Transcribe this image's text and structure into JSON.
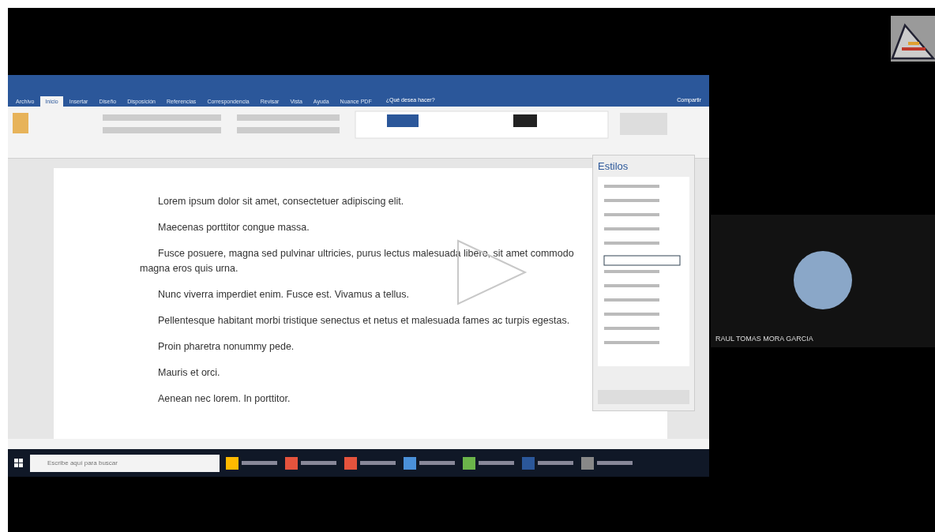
{
  "word": {
    "tabs": [
      {
        "label": "Archivo",
        "selected": false
      },
      {
        "label": "Inicio",
        "selected": true
      },
      {
        "label": "Insertar",
        "selected": false
      },
      {
        "label": "Diseño",
        "selected": false
      },
      {
        "label": "Disposición",
        "selected": false
      },
      {
        "label": "Referencias",
        "selected": false
      },
      {
        "label": "Correspondencia",
        "selected": false
      },
      {
        "label": "Revisar",
        "selected": false
      },
      {
        "label": "Vista",
        "selected": false
      },
      {
        "label": "Ayuda",
        "selected": false
      },
      {
        "label": "Nuance PDF",
        "selected": false
      }
    ],
    "tell_me": "¿Qué desea hacer?",
    "share": "Compartir",
    "paragraphs": [
      "Lorem ipsum dolor sit amet, consectetuer adipiscing elit.",
      "Maecenas porttitor congue massa.",
      "Fusce posuere, magna sed pulvinar ultricies, purus lectus malesuada libero, sit amet commodo magna eros quis urna.",
      "Nunc viverra imperdiet enim. Fusce est. Vivamus a tellus.",
      "Pellentesque habitant morbi tristique senectus et netus et malesuada fames ac turpis egestas.",
      "Proin pharetra nonummy pede.",
      "Mauris et orci.",
      "Aenean nec lorem. In porttitor."
    ],
    "styles_pane": {
      "title": "Estilos"
    },
    "taskbar": {
      "search": {
        "placeholder": "Escribe aquí para buscar"
      }
    }
  },
  "participant": {
    "name": "RAUL TOMAS MORA GARCIA"
  }
}
